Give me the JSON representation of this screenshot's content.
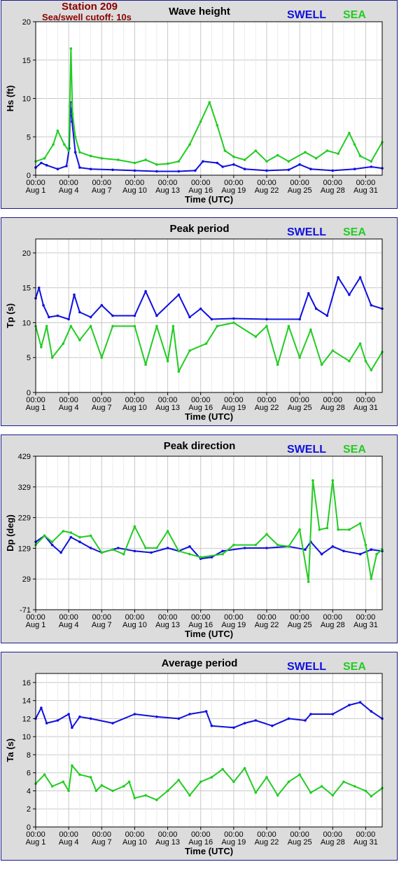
{
  "station": {
    "line1": "Station 209",
    "line2": "Sea/swell cutoff: 10s"
  },
  "legend": {
    "swell": "SWELL",
    "sea": "SEA",
    "swell_color": "#1010e0",
    "sea_color": "#22cc22"
  },
  "x_axis": {
    "label": "Time (UTC)",
    "ticks": [
      {
        "time": "00:00",
        "date": "Aug 1"
      },
      {
        "time": "00:00",
        "date": "Aug 4"
      },
      {
        "time": "00:00",
        "date": "Aug 7"
      },
      {
        "time": "00:00",
        "date": "Aug 10"
      },
      {
        "time": "00:00",
        "date": "Aug 13"
      },
      {
        "time": "00:00",
        "date": "Aug 16"
      },
      {
        "time": "00:00",
        "date": "Aug 19"
      },
      {
        "time": "00:00",
        "date": "Aug 22"
      },
      {
        "time": "00:00",
        "date": "Aug 25"
      },
      {
        "time": "00:00",
        "date": "Aug 28"
      },
      {
        "time": "00:00",
        "date": "Aug 31"
      }
    ],
    "tick_days": [
      1,
      4,
      7,
      10,
      13,
      16,
      19,
      22,
      25,
      28,
      31
    ],
    "range_days": [
      1,
      32.5
    ]
  },
  "chart_data": [
    {
      "type": "line",
      "title": "Wave height",
      "ylabel": "Hs (ft)",
      "ylim": [
        0,
        20
      ],
      "yticks": [
        0,
        5,
        10,
        15,
        20
      ],
      "grid": true,
      "series": [
        {
          "name": "SWELL",
          "points": [
            [
              1,
              1.0
            ],
            [
              1.5,
              1.6
            ],
            [
              2,
              1.3
            ],
            [
              3,
              0.8
            ],
            [
              3.8,
              1.2
            ],
            [
              4.05,
              3.5
            ],
            [
              4.15,
              9.5
            ],
            [
              4.3,
              7.0
            ],
            [
              4.6,
              3.0
            ],
            [
              5,
              1.0
            ],
            [
              6,
              0.8
            ],
            [
              8,
              0.7
            ],
            [
              10,
              0.6
            ],
            [
              12,
              0.5
            ],
            [
              14,
              0.5
            ],
            [
              15.5,
              0.6
            ],
            [
              16.2,
              1.8
            ],
            [
              17.5,
              1.6
            ],
            [
              18,
              1.1
            ],
            [
              19,
              1.4
            ],
            [
              20,
              0.8
            ],
            [
              22,
              0.6
            ],
            [
              24,
              0.7
            ],
            [
              25,
              1.4
            ],
            [
              26,
              0.8
            ],
            [
              28,
              0.6
            ],
            [
              30,
              0.8
            ],
            [
              31.5,
              1.1
            ],
            [
              32.5,
              0.9
            ]
          ]
        },
        {
          "name": "SEA",
          "points": [
            [
              1,
              1.8
            ],
            [
              1.8,
              2.2
            ],
            [
              2.6,
              4.0
            ],
            [
              3.0,
              5.8
            ],
            [
              3.6,
              4.0
            ],
            [
              4.0,
              3.2
            ],
            [
              4.1,
              9.0
            ],
            [
              4.2,
              16.5
            ],
            [
              4.35,
              8.0
            ],
            [
              4.6,
              5.0
            ],
            [
              5,
              3.0
            ],
            [
              6,
              2.5
            ],
            [
              7,
              2.2
            ],
            [
              8.5,
              2.0
            ],
            [
              10,
              1.6
            ],
            [
              11,
              2.0
            ],
            [
              12,
              1.4
            ],
            [
              13,
              1.5
            ],
            [
              14,
              1.8
            ],
            [
              15,
              4.0
            ],
            [
              16,
              7.0
            ],
            [
              16.8,
              9.5
            ],
            [
              17.5,
              6.5
            ],
            [
              18.2,
              3.2
            ],
            [
              19,
              2.4
            ],
            [
              20,
              2.0
            ],
            [
              21,
              3.2
            ],
            [
              22,
              1.8
            ],
            [
              23,
              2.6
            ],
            [
              24,
              1.8
            ],
            [
              25.5,
              3.0
            ],
            [
              26.5,
              2.2
            ],
            [
              27.5,
              3.2
            ],
            [
              28.5,
              2.8
            ],
            [
              29.5,
              5.5
            ],
            [
              30,
              4.0
            ],
            [
              30.5,
              2.5
            ],
            [
              31.5,
              1.8
            ],
            [
              32.5,
              4.3
            ]
          ]
        }
      ]
    },
    {
      "type": "line",
      "title": "Peak period",
      "ylabel": "Tp (s)",
      "ylim": [
        0,
        22
      ],
      "yticks": [
        0,
        5,
        10,
        15,
        20
      ],
      "grid": true,
      "series": [
        {
          "name": "SWELL",
          "points": [
            [
              1,
              13.5
            ],
            [
              1.3,
              15.0
            ],
            [
              1.7,
              12.5
            ],
            [
              2.2,
              10.8
            ],
            [
              3,
              11.0
            ],
            [
              4,
              10.5
            ],
            [
              4.5,
              14.0
            ],
            [
              5,
              11.5
            ],
            [
              6,
              10.8
            ],
            [
              7,
              12.5
            ],
            [
              8,
              11.0
            ],
            [
              10,
              11.0
            ],
            [
              11,
              14.5
            ],
            [
              12,
              11.0
            ],
            [
              14,
              14.0
            ],
            [
              15,
              10.8
            ],
            [
              16,
              12.0
            ],
            [
              17,
              10.5
            ],
            [
              19,
              10.6
            ],
            [
              22,
              10.5
            ],
            [
              25,
              10.5
            ],
            [
              25.8,
              14.2
            ],
            [
              26.5,
              12.0
            ],
            [
              27.5,
              11.0
            ],
            [
              28.5,
              16.5
            ],
            [
              29.5,
              14.0
            ],
            [
              30.5,
              16.5
            ],
            [
              31.5,
              12.5
            ],
            [
              32.5,
              12.0
            ]
          ]
        },
        {
          "name": "SEA",
          "points": [
            [
              1,
              9.5
            ],
            [
              1.5,
              6.5
            ],
            [
              2,
              9.5
            ],
            [
              2.5,
              5.0
            ],
            [
              3.5,
              7.0
            ],
            [
              4.2,
              9.5
            ],
            [
              5,
              7.5
            ],
            [
              6,
              9.5
            ],
            [
              7,
              5.0
            ],
            [
              8,
              9.5
            ],
            [
              10,
              9.5
            ],
            [
              11,
              4.0
            ],
            [
              12,
              9.5
            ],
            [
              13,
              4.5
            ],
            [
              13.5,
              9.5
            ],
            [
              14,
              3.0
            ],
            [
              15,
              6.0
            ],
            [
              16.5,
              7.0
            ],
            [
              17.5,
              9.5
            ],
            [
              19,
              10.0
            ],
            [
              21,
              8.0
            ],
            [
              22,
              9.5
            ],
            [
              23,
              4.0
            ],
            [
              24,
              9.5
            ],
            [
              25,
              5.0
            ],
            [
              26,
              9.0
            ],
            [
              27,
              4.0
            ],
            [
              28,
              6.0
            ],
            [
              29.5,
              4.5
            ],
            [
              30.5,
              7.0
            ],
            [
              31,
              4.5
            ],
            [
              31.5,
              3.2
            ],
            [
              32.5,
              5.8
            ]
          ]
        }
      ]
    },
    {
      "type": "line",
      "title": "Peak direction",
      "ylabel": "Dp (deg)",
      "ylim": [
        -71,
        429
      ],
      "yticks": [
        -71,
        29,
        129,
        229,
        329,
        429
      ],
      "grid": true,
      "series": [
        {
          "name": "SWELL",
          "points": [
            [
              1,
              150
            ],
            [
              1.8,
              170
            ],
            [
              2.5,
              140
            ],
            [
              3.3,
              115
            ],
            [
              4.2,
              165
            ],
            [
              5,
              150
            ],
            [
              6,
              130
            ],
            [
              7,
              115
            ],
            [
              8.5,
              130
            ],
            [
              10,
              120
            ],
            [
              11.5,
              115
            ],
            [
              13,
              130
            ],
            [
              14,
              120
            ],
            [
              15,
              135
            ],
            [
              16,
              95
            ],
            [
              17,
              100
            ],
            [
              18,
              120
            ],
            [
              20,
              130
            ],
            [
              22,
              130
            ],
            [
              24,
              135
            ],
            [
              25.5,
              125
            ],
            [
              26,
              150
            ],
            [
              27,
              110
            ],
            [
              28,
              135
            ],
            [
              29,
              120
            ],
            [
              30.5,
              110
            ],
            [
              31.5,
              125
            ],
            [
              32.5,
              120
            ]
          ]
        },
        {
          "name": "SEA",
          "points": [
            [
              1,
              140
            ],
            [
              1.8,
              170
            ],
            [
              2.5,
              150
            ],
            [
              3.5,
              185
            ],
            [
              4.2,
              180
            ],
            [
              5,
              165
            ],
            [
              6,
              170
            ],
            [
              7,
              115
            ],
            [
              8,
              125
            ],
            [
              9,
              110
            ],
            [
              10,
              200
            ],
            [
              11,
              130
            ],
            [
              12,
              130
            ],
            [
              13,
              185
            ],
            [
              14,
              120
            ],
            [
              15,
              110
            ],
            [
              16,
              100
            ],
            [
              18,
              110
            ],
            [
              19,
              140
            ],
            [
              21,
              140
            ],
            [
              22,
              175
            ],
            [
              23,
              140
            ],
            [
              24,
              135
            ],
            [
              25,
              190
            ],
            [
              25.8,
              20
            ],
            [
              26.2,
              350
            ],
            [
              26.8,
              190
            ],
            [
              27.5,
              195
            ],
            [
              28,
              350
            ],
            [
              28.5,
              190
            ],
            [
              29.5,
              190
            ],
            [
              30.5,
              210
            ],
            [
              31,
              140
            ],
            [
              31.5,
              30
            ],
            [
              32,
              110
            ],
            [
              32.5,
              125
            ]
          ]
        }
      ]
    },
    {
      "type": "line",
      "title": "Average period",
      "ylabel": "Ta (s)",
      "ylim": [
        0,
        17
      ],
      "yticks": [
        0,
        2,
        4,
        6,
        8,
        10,
        12,
        14,
        16
      ],
      "grid": true,
      "series": [
        {
          "name": "SWELL",
          "points": [
            [
              1,
              12.0
            ],
            [
              1.5,
              13.2
            ],
            [
              2,
              11.5
            ],
            [
              3,
              11.8
            ],
            [
              4,
              12.5
            ],
            [
              4.3,
              11.0
            ],
            [
              5,
              12.2
            ],
            [
              6,
              12.0
            ],
            [
              8,
              11.5
            ],
            [
              10,
              12.5
            ],
            [
              12,
              12.2
            ],
            [
              14,
              12.0
            ],
            [
              15,
              12.5
            ],
            [
              16.5,
              12.8
            ],
            [
              17,
              11.2
            ],
            [
              19,
              11.0
            ],
            [
              20,
              11.5
            ],
            [
              21,
              11.8
            ],
            [
              22.5,
              11.2
            ],
            [
              24,
              12.0
            ],
            [
              25.5,
              11.8
            ],
            [
              26,
              12.5
            ],
            [
              28,
              12.5
            ],
            [
              29.5,
              13.5
            ],
            [
              30.5,
              13.8
            ],
            [
              31.5,
              12.8
            ],
            [
              32.5,
              12.0
            ]
          ]
        },
        {
          "name": "SEA",
          "points": [
            [
              1,
              4.8
            ],
            [
              1.8,
              5.8
            ],
            [
              2.5,
              4.5
            ],
            [
              3.5,
              5.0
            ],
            [
              4,
              4.0
            ],
            [
              4.3,
              6.8
            ],
            [
              5,
              5.8
            ],
            [
              6,
              5.5
            ],
            [
              6.5,
              4.0
            ],
            [
              7,
              4.6
            ],
            [
              8,
              4.0
            ],
            [
              9,
              4.5
            ],
            [
              9.5,
              5.0
            ],
            [
              10,
              3.2
            ],
            [
              11,
              3.5
            ],
            [
              12,
              3.0
            ],
            [
              13,
              4.0
            ],
            [
              14,
              5.2
            ],
            [
              15,
              3.5
            ],
            [
              16,
              5.0
            ],
            [
              17,
              5.5
            ],
            [
              18,
              6.4
            ],
            [
              19,
              5.0
            ],
            [
              20,
              6.5
            ],
            [
              21,
              3.8
            ],
            [
              22,
              5.5
            ],
            [
              23,
              3.5
            ],
            [
              24,
              5.0
            ],
            [
              25,
              5.8
            ],
            [
              26,
              3.8
            ],
            [
              27,
              4.5
            ],
            [
              28,
              3.5
            ],
            [
              29,
              5.0
            ],
            [
              30,
              4.5
            ],
            [
              31,
              4.0
            ],
            [
              31.5,
              3.4
            ],
            [
              32.5,
              4.3
            ]
          ]
        }
      ]
    }
  ]
}
